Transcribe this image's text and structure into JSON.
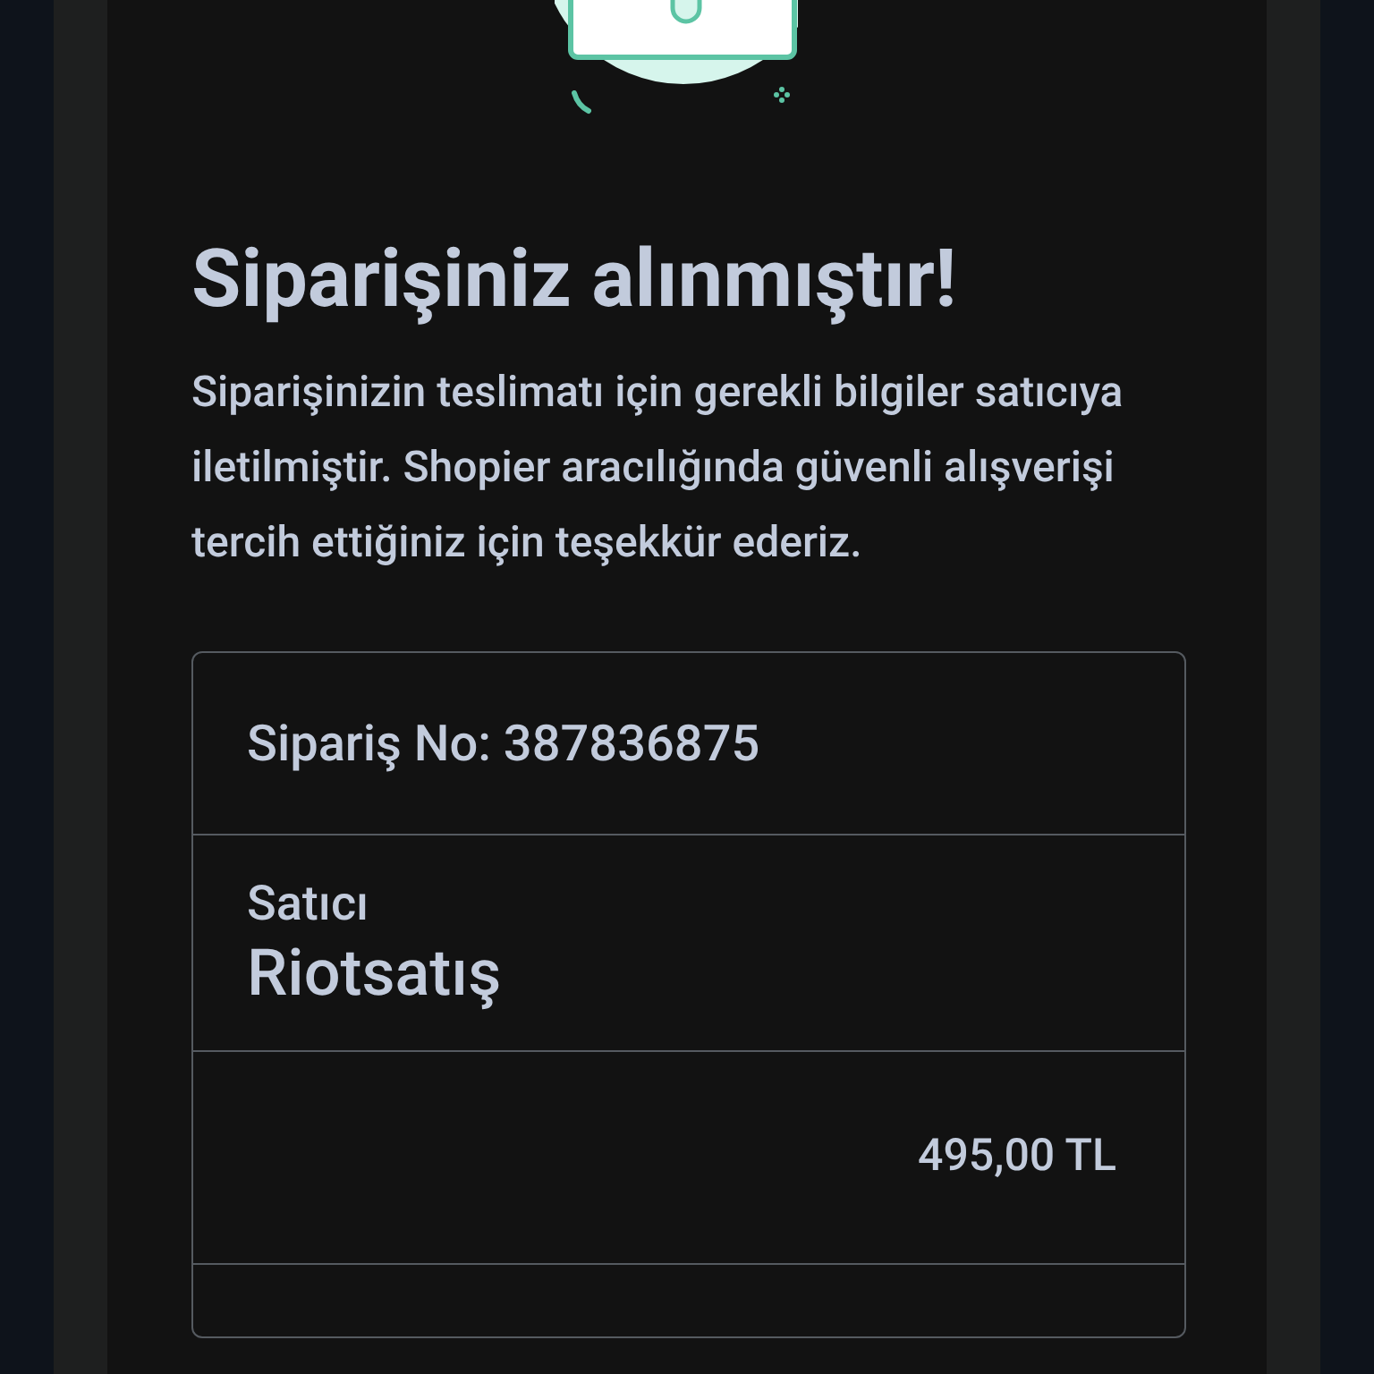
{
  "title": "Siparişiniz alınmıştır!",
  "message": "Siparişinizin teslimatı için gerekli bilgiler satıcıya iletilmiştir. Shopier aracılığında güvenli alışverişi tercih ettiğiniz için teşekkür ederiz.",
  "order": {
    "order_number": "Sipariş No: 387836875",
    "seller_label": "Satıcı",
    "seller_name": "Riotsatış",
    "amount": "495,00 TL"
  }
}
